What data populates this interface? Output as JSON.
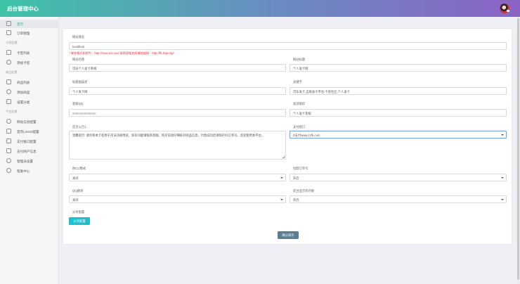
{
  "app": {
    "title": "后台管理中心"
  },
  "sidebar": {
    "items": [
      {
        "label": "首页",
        "icon": "home-icon",
        "active": true
      },
      {
        "label": "订单管理",
        "icon": "order-icon"
      },
      {
        "label": "卡密列表",
        "icon": "list-icon"
      },
      {
        "label": "添加卡密",
        "icon": "add-icon"
      },
      {
        "label": "商品列表",
        "icon": "list-icon"
      },
      {
        "label": "添加商品",
        "icon": "add-icon"
      },
      {
        "label": "设置分类",
        "icon": "category-icon"
      },
      {
        "label": "网站信息配置",
        "icon": "info-icon"
      },
      {
        "label": "首页LOGO配置",
        "icon": "image-icon"
      },
      {
        "label": "支付接口配置",
        "icon": "payment-icon"
      },
      {
        "label": "支付商户信息",
        "icon": "merchant-icon"
      },
      {
        "label": "管理员设置",
        "icon": "user-icon"
      },
      {
        "label": "帮助中心",
        "icon": "help-icon"
      }
    ],
    "groups": [
      "卡密配置",
      "商品配置",
      "平台配置"
    ]
  },
  "form": {
    "domain_label": "网站域名",
    "domain_value": "localhost",
    "domain_hint": "* 域名格式如把为：http://xxxx.xxx.xxx/ 前两段域名的域名链接：http://fk.zlgw.top/",
    "site_name_label": "网站名称",
    "site_name_value": "可乐个人发卡系统",
    "site_title_label": "网站标题",
    "site_title_value": "个人发卡网",
    "subtitle_label": "标题副描述",
    "subtitle_value": "个人发卡网",
    "keywords_label": "关键字",
    "keywords_value": "可乐发卡,自助发卡平台,卡密社区,个人发卡",
    "qq_label": "客服QQ",
    "qq_value": "88888888888888",
    "footer_label": "底部版权",
    "footer_value": "个人发卡系统",
    "notice_label": "首页公告1",
    "notice_value": "温馨提示: 请勿将本卡密用于违法违规用途，如有问题请联系客服。购买前请仔细核对商品信息，付款成功后请保存好订单号。欢迎使用本平台。",
    "pay_label": "支付接口",
    "pay_value": "Z支付www.zzfk.com",
    "anticc_label": "防CC模式",
    "anticc_value": "关闭",
    "orderquery_label": "拉取订单号",
    "orderquery_value": "开启",
    "qqpay_label": "QQ跳转",
    "qqpay_value": "关闭",
    "stock_label": "前台显示库存数",
    "stock_value": "开启",
    "share_label": "分享配置",
    "share_btn": "分享配置",
    "submit_btn": "确认保存"
  },
  "colors": {
    "accent": "#3ec3a6",
    "purple": "#8b63c6",
    "cyan": "#1fbfce",
    "slate": "#5a7d95",
    "hint": "#e0313b"
  }
}
